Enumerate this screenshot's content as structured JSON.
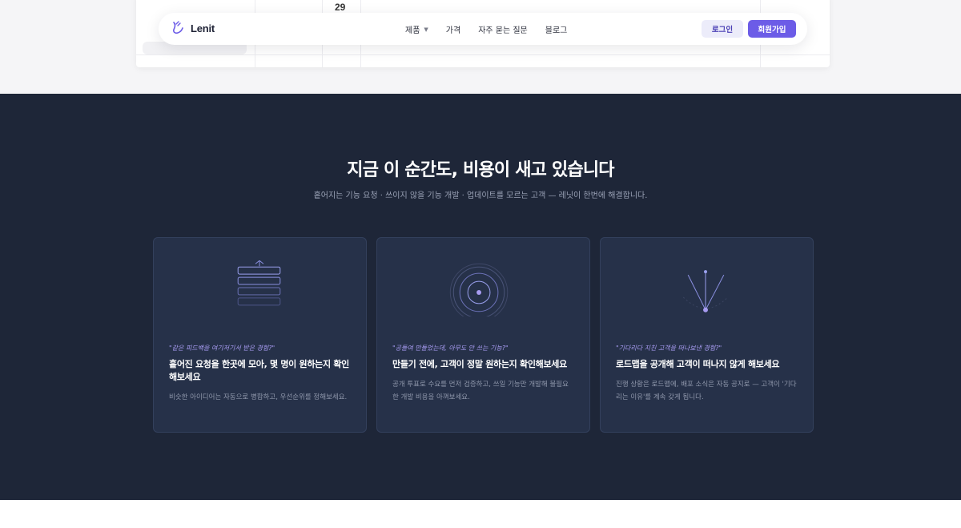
{
  "peek": {
    "number": "29"
  },
  "navbar": {
    "brand": "Lenit",
    "links": [
      {
        "label": "제품",
        "caret": "▼"
      },
      {
        "label": "가격"
      },
      {
        "label": "자주 묻는 질문"
      },
      {
        "label": "블로그"
      }
    ],
    "login": "로그인",
    "signup": "회원가입"
  },
  "section": {
    "title": "지금 이 순간도, 비용이 새고 있습니다",
    "subtitle": "흩어지는 기능 요청 · 쓰이지 않을 기능 개발 · 업데이트를 모르는 고객 — 레닛이 한번에 해결합니다.",
    "cards": [
      {
        "quote": "\"같은 피드백을 여기저기서 받은 경험?\"",
        "title": "흩어진 요청을 한곳에 모아, 몇 명이 원하는지 확인해보세요",
        "desc": "비슷한 아이디어는 자동으로 병합하고, 우선순위를 정해보세요."
      },
      {
        "quote": "\"공들여 만들었는데, 아무도 안 쓰는 기능?\"",
        "title": "만들기 전에, 고객이 정말 원하는지 확인해보세요",
        "desc": "공개 투표로 수요를 먼저 검증하고, 쓰일 기능만 개발해 불필요한 개발 비용을 아껴보세요."
      },
      {
        "quote": "\"기다리다 지친 고객을 떠나보낸 경험?\"",
        "title": "로드맵을 공개해 고객이 떠나지 않게 해보세요",
        "desc": "진행 상황은 로드맵에, 배포 소식은 자동 공지로 — 고객이 '기다리는 이유'를 계속 갖게 됩니다."
      }
    ]
  },
  "colors": {
    "accent": "#6c5ce7",
    "dark_bg": "#1e2638",
    "card_bg": "#263149",
    "quote": "#a89cf2"
  },
  "icons": [
    "stack-icon",
    "target-icon",
    "fan-icon",
    "lenit-logo-icon"
  ]
}
